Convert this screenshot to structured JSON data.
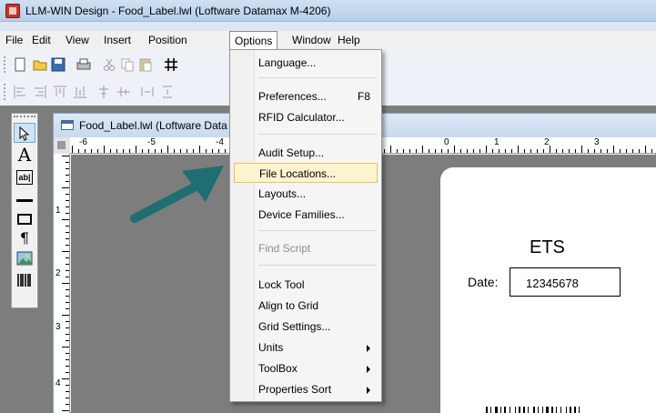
{
  "window": {
    "title": "LLM-WIN Design - Food_Label.lwl (Loftware Datamax M-4206)"
  },
  "menubar": {
    "items": [
      "File",
      "Edit",
      "View",
      "Insert",
      "Position",
      "Options",
      "Window",
      "Help"
    ],
    "open": "Options"
  },
  "document": {
    "title": "Food_Label.lwl (Loftware Data",
    "ruler_h_labels": [
      "-6",
      "-5",
      "-4",
      "0",
      "1",
      "2",
      "3"
    ],
    "ruler_v_labels": [
      "1",
      "2",
      "3",
      "4"
    ]
  },
  "label": {
    "heading": "ETS",
    "date_label": "Date:",
    "date_value": "12345678"
  },
  "options_menu": {
    "items": [
      {
        "label": "Language...",
        "shortcut": ""
      },
      {
        "label": "Preferences...",
        "shortcut": "F8"
      },
      {
        "label": "RFID Calculator...",
        "shortcut": ""
      },
      {
        "label": "Audit Setup...",
        "shortcut": ""
      },
      {
        "label": "File Locations...",
        "shortcut": "",
        "highlighted": true
      },
      {
        "label": "Layouts...",
        "shortcut": ""
      },
      {
        "label": "Device Families...",
        "shortcut": ""
      },
      {
        "label": "Find Script",
        "shortcut": "",
        "disabled": true
      },
      {
        "label": "Lock Tool",
        "shortcut": ""
      },
      {
        "label": "Align to Grid",
        "shortcut": ""
      },
      {
        "label": "Grid Settings...",
        "shortcut": ""
      },
      {
        "label": "Units",
        "shortcut": "",
        "submenu": true
      },
      {
        "label": "ToolBox",
        "shortcut": "",
        "submenu": true
      },
      {
        "label": "Properties Sort",
        "shortcut": "",
        "submenu": true
      }
    ]
  },
  "toolbox": {
    "tools": [
      "pointer-icon",
      "text-tool-icon",
      "field-tool-icon",
      "line-tool-icon",
      "box-tool-icon",
      "paragraph-tool-icon",
      "image-tool-icon",
      "barcode-tool-icon"
    ]
  },
  "colors": {
    "accent": "#1f6f72",
    "highlight": "#fdf3cf",
    "titlebar": "#c4d8ee"
  }
}
